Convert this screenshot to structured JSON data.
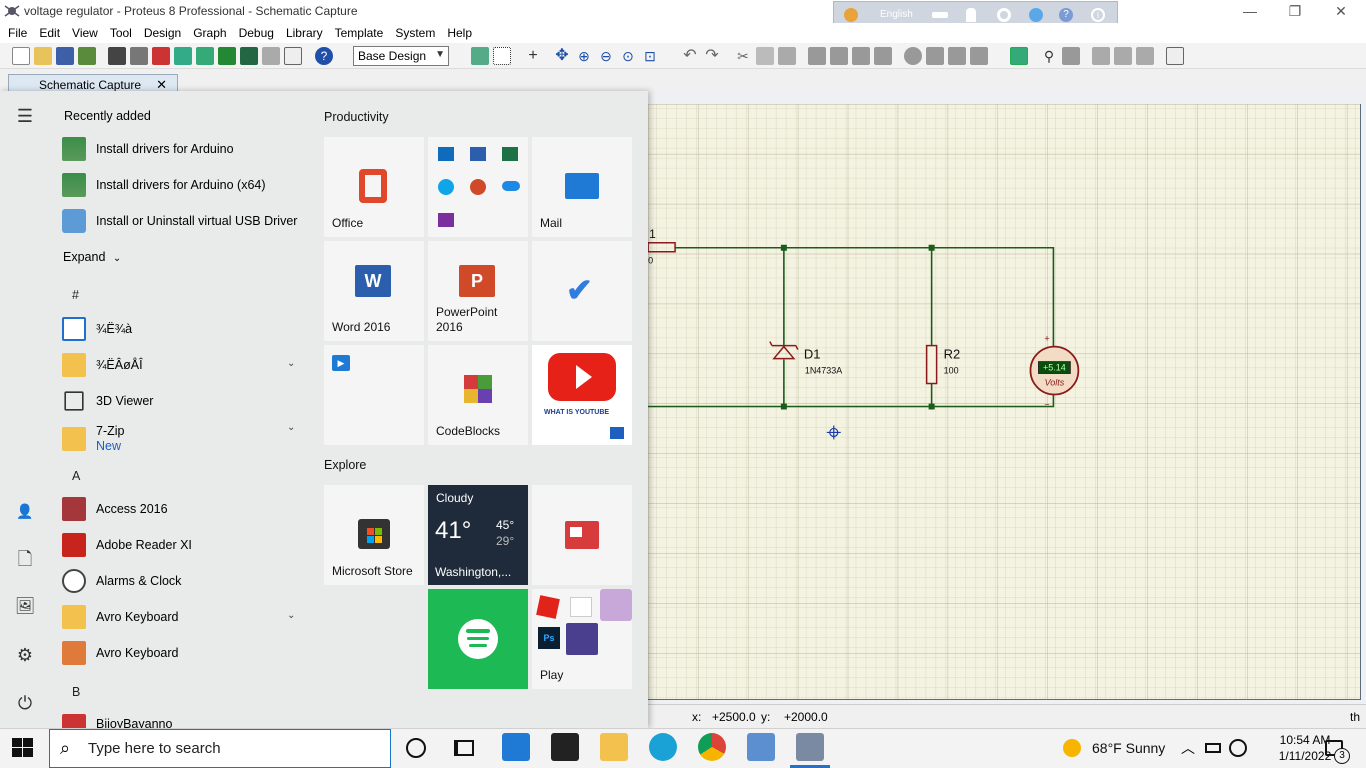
{
  "window": {
    "title": "voltage regulator - Proteus 8 Professional - Schematic Capture",
    "language": "English"
  },
  "menu": [
    "File",
    "Edit",
    "View",
    "Tool",
    "Design",
    "Graph",
    "Debug",
    "Library",
    "Template",
    "System",
    "Help"
  ],
  "toolbar": {
    "design_select": "Base Design"
  },
  "tab": {
    "label": "Schematic Capture",
    "close": "✕"
  },
  "schematic": {
    "partial_label_top": "1",
    "partial_label_value": "0",
    "d1": {
      "ref": "D1",
      "value": "1N4733A"
    },
    "r2": {
      "ref": "R2",
      "value": "100"
    },
    "voltmeter": {
      "reading": "+5.14",
      "unit": "Volts",
      "plus": "+",
      "minus": "−"
    }
  },
  "statusbar": {
    "x_label": "x:",
    "x_value": "+2500.0",
    "y_label": "y:",
    "y_value": "+2000.0",
    "right_text": "th"
  },
  "startmenu": {
    "recently_added_title": "Recently added",
    "recent": [
      {
        "label": "Install drivers for Arduino",
        "icon": "arduino-driver-icon"
      },
      {
        "label": "Install drivers for Arduino (x64)",
        "icon": "arduino-driver-icon"
      },
      {
        "label": "Install or Uninstall virtual USB Driver",
        "icon": "usb-driver-icon"
      }
    ],
    "expand_label": "Expand",
    "hash_header": "#",
    "apps_hash": [
      {
        "label": "¾Ë¾à",
        "icon": "app-window-icon"
      },
      {
        "label": "¾ËÂøÅÎ",
        "icon": "folder-icon"
      },
      {
        "label": "3D Viewer",
        "icon": "cube-icon"
      },
      {
        "label": "7-Zip",
        "sub": "New",
        "icon": "folder-icon"
      }
    ],
    "a_header": "A",
    "apps_a": [
      {
        "label": "Access 2016",
        "icon": "access-icon"
      },
      {
        "label": "Adobe Reader XI",
        "icon": "adobe-icon"
      },
      {
        "label": "Alarms & Clock",
        "icon": "clock-icon"
      },
      {
        "label": "Avro Keyboard",
        "icon": "folder-icon"
      },
      {
        "label": "Avro Keyboard",
        "icon": "avro-icon"
      }
    ],
    "b_header": "B",
    "apps_b_partial": "BijoyBayanno",
    "productivity_title": "Productivity",
    "explore_title": "Explore",
    "tiles": {
      "office": "Office",
      "mail": "Mail",
      "word": "Word 2016",
      "powerpoint": "PowerPoint 2016",
      "codeblocks": "CodeBlocks",
      "youtube_caption": "WHAT IS YOUTUBE",
      "store": "Microsoft Store",
      "weather": {
        "condition": "Cloudy",
        "temp": "41°",
        "high": "45°",
        "low": "29°",
        "location": "Washington,..."
      },
      "play": "Play",
      "ps_label": "Ps"
    }
  },
  "taskbar": {
    "search_placeholder": "Type here to search",
    "weather": "68°F  Sunny",
    "time": "10:54 AM",
    "date": "1/11/2022",
    "notifications": "3"
  }
}
